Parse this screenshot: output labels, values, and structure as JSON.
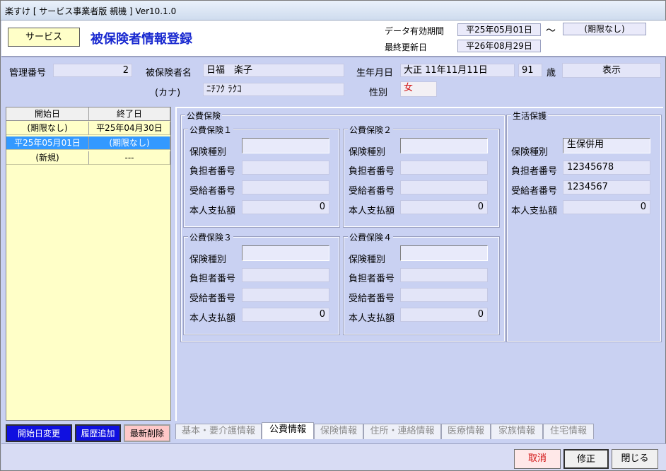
{
  "window": {
    "title": "楽すけ [ サービス事業者版 親機 ] Ver10.1.0"
  },
  "header": {
    "service_button": "サービス",
    "page_title": "被保険者情報登録",
    "validity_label": "データ有効期間",
    "validity_from": "平25年05月01日",
    "tilde": "〜",
    "validity_to": "(期限なし)",
    "updated_label": "最終更新日",
    "updated_date": "平26年08月29日"
  },
  "person": {
    "mgmt_no_label": "管理番号",
    "mgmt_no": "2",
    "name_label": "被保険者名",
    "name": "日福　楽子",
    "kana_label": "(カナ)",
    "kana": "ﾆﾁﾌｸ ﾗｸｺ",
    "birth_label": "生年月日",
    "birth": "大正 11年11月11日",
    "age": "91",
    "age_unit": "歳",
    "show_button": "表示",
    "sex_label": "性別",
    "sex": "女"
  },
  "history": {
    "headers": [
      "開始日",
      "終了日"
    ],
    "rows": [
      {
        "start": "(期限なし)",
        "end": "平25年04月30日"
      },
      {
        "start": "平25年05月01日",
        "end": "(期限なし)"
      },
      {
        "start": "(新規)",
        "end": "---"
      }
    ],
    "selected_index": 1
  },
  "left_buttons": {
    "change_start": "開始日変更",
    "add_history": "履歴追加",
    "delete_latest": "最新削除"
  },
  "public": {
    "section_title": "公費保険",
    "labels": {
      "type": "保険種別",
      "payer": "負担者番号",
      "recipient": "受給者番号",
      "copay": "本人支払額"
    },
    "groups": [
      {
        "title": "公費保険１",
        "type": "",
        "payer": "",
        "recipient": "",
        "copay": "0"
      },
      {
        "title": "公費保険２",
        "type": "",
        "payer": "",
        "recipient": "",
        "copay": "0"
      },
      {
        "title": "公費保険３",
        "type": "",
        "payer": "",
        "recipient": "",
        "copay": "0"
      },
      {
        "title": "公費保険４",
        "type": "",
        "payer": "",
        "recipient": "",
        "copay": "0"
      }
    ]
  },
  "welfare": {
    "title": "生活保護",
    "type": "生保併用",
    "payer": "12345678",
    "recipient": "1234567",
    "copay": "0"
  },
  "tabs": [
    "基本・要介護情報",
    "公費情報",
    "保険情報",
    "住所・連絡情報",
    "医療情報",
    "家族情報",
    "住宅情報"
  ],
  "active_tab": 1,
  "footer": {
    "cancel": "取消",
    "edit": "修正",
    "close": "閉じる"
  },
  "colors": {
    "background": "#c9d1f2",
    "title_blue": "#1a2ad0",
    "selected_row": "#3399ff",
    "list_bg": "#ffffc8"
  }
}
